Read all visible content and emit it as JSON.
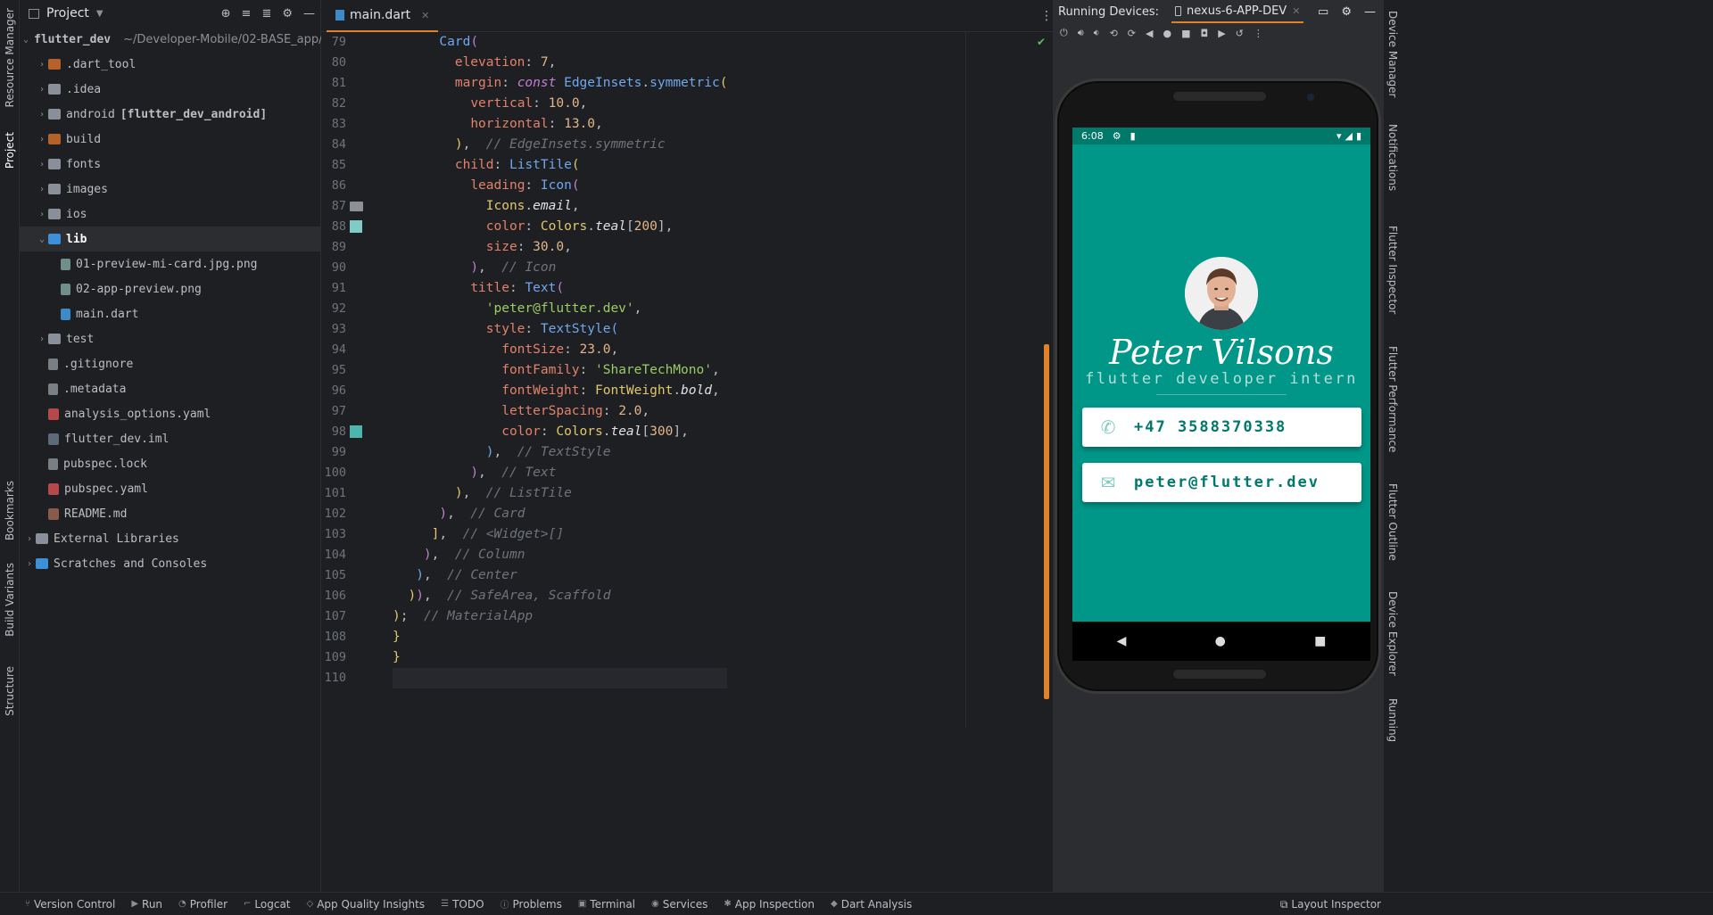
{
  "left_strip": {
    "resource_manager": "Resource Manager",
    "project": "Project",
    "bookmarks": "Bookmarks",
    "build_variants": "Build Variants",
    "structure": "Structure"
  },
  "project_panel": {
    "title": "Project",
    "tree": [
      {
        "label": "flutter_dev",
        "hint": "~/Developer-Mobile/02-BASE_app/",
        "indent": 0,
        "arrow": "v",
        "icon": "folder blue"
      },
      {
        "label": ".dart_tool",
        "indent": 1,
        "arrow": ">",
        "icon": "folder orange"
      },
      {
        "label": ".idea",
        "indent": 1,
        "arrow": ">",
        "icon": "folder"
      },
      {
        "label": "android",
        "bold_hint": "[flutter_dev_android]",
        "indent": 1,
        "arrow": ">",
        "icon": "folder"
      },
      {
        "label": "build",
        "indent": 1,
        "arrow": ">",
        "icon": "folder orange"
      },
      {
        "label": "fonts",
        "indent": 1,
        "arrow": ">",
        "icon": "folder"
      },
      {
        "label": "images",
        "indent": 1,
        "arrow": ">",
        "icon": "folder"
      },
      {
        "label": "ios",
        "indent": 1,
        "arrow": ">",
        "icon": "folder"
      },
      {
        "label": "lib",
        "indent": 1,
        "arrow": "v",
        "icon": "folder blue",
        "selected": true
      },
      {
        "label": "01-preview-mi-card.jpg.png",
        "indent": 2,
        "arrow": "",
        "icon": "file-img"
      },
      {
        "label": "02-app-preview.png",
        "indent": 2,
        "arrow": "",
        "icon": "file-img"
      },
      {
        "label": "main.dart",
        "indent": 2,
        "arrow": "",
        "icon": "file-dart"
      },
      {
        "label": "test",
        "indent": 1,
        "arrow": ">",
        "icon": "folder"
      },
      {
        "label": ".gitignore",
        "indent": 1,
        "arrow": "",
        "icon": "file-gen"
      },
      {
        "label": ".metadata",
        "indent": 1,
        "arrow": "",
        "icon": "file-gen"
      },
      {
        "label": "analysis_options.yaml",
        "indent": 1,
        "arrow": "",
        "icon": "file-yaml"
      },
      {
        "label": "flutter_dev.iml",
        "indent": 1,
        "arrow": "",
        "icon": "file-iml"
      },
      {
        "label": "pubspec.lock",
        "indent": 1,
        "arrow": "",
        "icon": "file-gen"
      },
      {
        "label": "pubspec.yaml",
        "indent": 1,
        "arrow": "",
        "icon": "file-yaml"
      },
      {
        "label": "README.md",
        "indent": 1,
        "arrow": "",
        "icon": "file-md"
      },
      {
        "label": "External Libraries",
        "indent": 0,
        "arrow": ">",
        "icon": "folder"
      },
      {
        "label": "Scratches and Consoles",
        "indent": 0,
        "arrow": ">",
        "icon": "folder blue"
      }
    ]
  },
  "editor": {
    "tab_label": "main.dart",
    "first_line": 79,
    "line_count": 32,
    "current_line": 110,
    "lines": [
      [
        [
          "      ",
          ""
        ],
        [
          "Card",
          "c-cls"
        ],
        [
          "(",
          "c-b2"
        ]
      ],
      [
        [
          "        ",
          ""
        ],
        [
          "elevation",
          "c-prop"
        ],
        [
          ": ",
          ""
        ],
        [
          "7",
          "c-num"
        ],
        [
          ",",
          ""
        ]
      ],
      [
        [
          "        ",
          ""
        ],
        [
          "margin",
          "c-prop"
        ],
        [
          ": ",
          ""
        ],
        [
          "const ",
          "c-kw"
        ],
        [
          "EdgeInsets",
          "c-cls"
        ],
        [
          ".",
          ""
        ],
        [
          "symmetric",
          "c-cls"
        ],
        [
          "(",
          "c-b1"
        ]
      ],
      [
        [
          "          ",
          ""
        ],
        [
          "vertical",
          "c-prop"
        ],
        [
          ": ",
          ""
        ],
        [
          "10.0",
          "c-num"
        ],
        [
          ",",
          ""
        ]
      ],
      [
        [
          "          ",
          ""
        ],
        [
          "horizontal",
          "c-prop"
        ],
        [
          ": ",
          ""
        ],
        [
          "13.0",
          "c-num"
        ],
        [
          ",",
          ""
        ]
      ],
      [
        [
          "        ",
          ""
        ],
        [
          ")",
          "c-b1"
        ],
        [
          ",  ",
          ""
        ],
        [
          "// EdgeInsets.symmetric",
          "c-cmt"
        ]
      ],
      [
        [
          "        ",
          ""
        ],
        [
          "child",
          "c-prop"
        ],
        [
          ": ",
          ""
        ],
        [
          "ListTile",
          "c-cls"
        ],
        [
          "(",
          "c-b1"
        ]
      ],
      [
        [
          "          ",
          ""
        ],
        [
          "leading",
          "c-prop"
        ],
        [
          ": ",
          ""
        ],
        [
          "Icon",
          "c-cls"
        ],
        [
          "(",
          "c-b2"
        ]
      ],
      [
        [
          "            ",
          ""
        ],
        [
          "Icons",
          "c-id"
        ],
        [
          ".",
          ""
        ],
        [
          "email",
          "c-em"
        ],
        [
          ",",
          ""
        ]
      ],
      [
        [
          "            ",
          ""
        ],
        [
          "color",
          "c-prop"
        ],
        [
          ": ",
          ""
        ],
        [
          "Colors",
          "c-id"
        ],
        [
          ".",
          ""
        ],
        [
          "teal",
          "c-em"
        ],
        [
          "[",
          ""
        ],
        [
          "200",
          "c-num"
        ],
        [
          "]",
          ""
        ],
        [
          ",",
          ""
        ]
      ],
      [
        [
          "            ",
          ""
        ],
        [
          "size",
          "c-prop"
        ],
        [
          ": ",
          ""
        ],
        [
          "30.0",
          "c-num"
        ],
        [
          ",",
          ""
        ]
      ],
      [
        [
          "          ",
          ""
        ],
        [
          ")",
          "c-b2"
        ],
        [
          ",  ",
          ""
        ],
        [
          "// Icon",
          "c-cmt"
        ]
      ],
      [
        [
          "          ",
          ""
        ],
        [
          "title",
          "c-prop"
        ],
        [
          ": ",
          ""
        ],
        [
          "Text",
          "c-cls"
        ],
        [
          "(",
          "c-b2"
        ]
      ],
      [
        [
          "            ",
          ""
        ],
        [
          "'peter@flutter.dev'",
          "c-str"
        ],
        [
          ",",
          ""
        ]
      ],
      [
        [
          "            ",
          ""
        ],
        [
          "style",
          "c-prop"
        ],
        [
          ": ",
          ""
        ],
        [
          "TextStyle",
          "c-cls"
        ],
        [
          "(",
          "c-b3"
        ]
      ],
      [
        [
          "              ",
          ""
        ],
        [
          "fontSize",
          "c-prop"
        ],
        [
          ": ",
          ""
        ],
        [
          "23.0",
          "c-num"
        ],
        [
          ",",
          ""
        ]
      ],
      [
        [
          "              ",
          ""
        ],
        [
          "fontFamily",
          "c-prop"
        ],
        [
          ": ",
          ""
        ],
        [
          "'ShareTechMono'",
          "c-str"
        ],
        [
          ",",
          ""
        ]
      ],
      [
        [
          "              ",
          ""
        ],
        [
          "fontWeight",
          "c-prop"
        ],
        [
          ": ",
          ""
        ],
        [
          "FontWeight",
          "c-id"
        ],
        [
          ".",
          ""
        ],
        [
          "bold",
          "c-em"
        ],
        [
          ",",
          ""
        ]
      ],
      [
        [
          "              ",
          ""
        ],
        [
          "letterSpacing",
          "c-prop"
        ],
        [
          ": ",
          ""
        ],
        [
          "2.0",
          "c-num"
        ],
        [
          ",",
          ""
        ]
      ],
      [
        [
          "              ",
          ""
        ],
        [
          "color",
          "c-prop"
        ],
        [
          ": ",
          ""
        ],
        [
          "Colors",
          "c-id"
        ],
        [
          ".",
          ""
        ],
        [
          "teal",
          "c-em"
        ],
        [
          "[",
          ""
        ],
        [
          "300",
          "c-num"
        ],
        [
          "]",
          ""
        ],
        [
          ",",
          ""
        ]
      ],
      [
        [
          "            ",
          ""
        ],
        [
          ")",
          "c-b3"
        ],
        [
          ",  ",
          ""
        ],
        [
          "// TextStyle",
          "c-cmt"
        ]
      ],
      [
        [
          "          ",
          ""
        ],
        [
          ")",
          "c-b2"
        ],
        [
          ",  ",
          ""
        ],
        [
          "// Text",
          "c-cmt"
        ]
      ],
      [
        [
          "        ",
          ""
        ],
        [
          ")",
          "c-b1"
        ],
        [
          ",  ",
          ""
        ],
        [
          "// ListTile",
          "c-cmt"
        ]
      ],
      [
        [
          "      ",
          ""
        ],
        [
          ")",
          "c-b2"
        ],
        [
          ",  ",
          ""
        ],
        [
          "// Card",
          "c-cmt"
        ]
      ],
      [
        [
          "     ",
          ""
        ],
        [
          "]",
          "c-b1"
        ],
        [
          ",  ",
          ""
        ],
        [
          "// <Widget>[]",
          "c-cmt"
        ]
      ],
      [
        [
          "    ",
          ""
        ],
        [
          ")",
          "c-b2"
        ],
        [
          ",  ",
          ""
        ],
        [
          "// Column",
          "c-cmt"
        ]
      ],
      [
        [
          "   ",
          ""
        ],
        [
          ")",
          "c-b3"
        ],
        [
          ",  ",
          ""
        ],
        [
          "// Center",
          "c-cmt"
        ]
      ],
      [
        [
          "  ",
          ""
        ],
        [
          ")",
          "c-b1"
        ],
        [
          ")",
          "c-b2"
        ],
        [
          ",  ",
          ""
        ],
        [
          "// SafeArea, Scaffold",
          "c-cmt"
        ]
      ],
      [
        [
          "",
          ""
        ],
        [
          ")",
          "c-b1"
        ],
        [
          ";  ",
          ""
        ],
        [
          "// MaterialApp",
          "c-cmt"
        ]
      ],
      [
        [
          "",
          ""
        ],
        [
          "}",
          "c-b1"
        ]
      ],
      [
        [
          "",
          ""
        ],
        [
          "}",
          "c-b1"
        ]
      ],
      [
        [
          "",
          ""
        ]
      ]
    ],
    "swatches": [
      {
        "line": 88,
        "color": "#80cbc4"
      },
      {
        "line": 98,
        "color": "#4db6ac"
      }
    ],
    "gutter_icon_line": 87
  },
  "devices": {
    "label": "Running Devices:",
    "device_tab": "nexus-6-APP-DEV"
  },
  "phone": {
    "time": "6:08",
    "name": "Peter Vilsons",
    "job": "flutter developer intern",
    "phone_number": "+47 3588370338",
    "email": "peter@flutter.dev",
    "colors": {
      "background": "#009688",
      "card_text": "#00796b",
      "icon": "#80cbc4"
    }
  },
  "right_strip": {
    "device_manager": "Device Manager",
    "notifications": "Notifications",
    "flutter_inspector": "Flutter Inspector",
    "flutter_performance": "Flutter Performance",
    "flutter_outline": "Flutter Outline",
    "device_explorer": "Device Explorer",
    "running": "Running"
  },
  "bottom_bar": {
    "version_control": "Version Control",
    "run": "Run",
    "profiler": "Profiler",
    "logcat": "Logcat",
    "app_quality": "App Quality Insights",
    "todo": "TODO",
    "problems": "Problems",
    "terminal": "Terminal",
    "services": "Services",
    "app_inspection": "App Inspection",
    "dart_analysis": "Dart Analysis",
    "layout_inspector": "Layout Inspector"
  }
}
